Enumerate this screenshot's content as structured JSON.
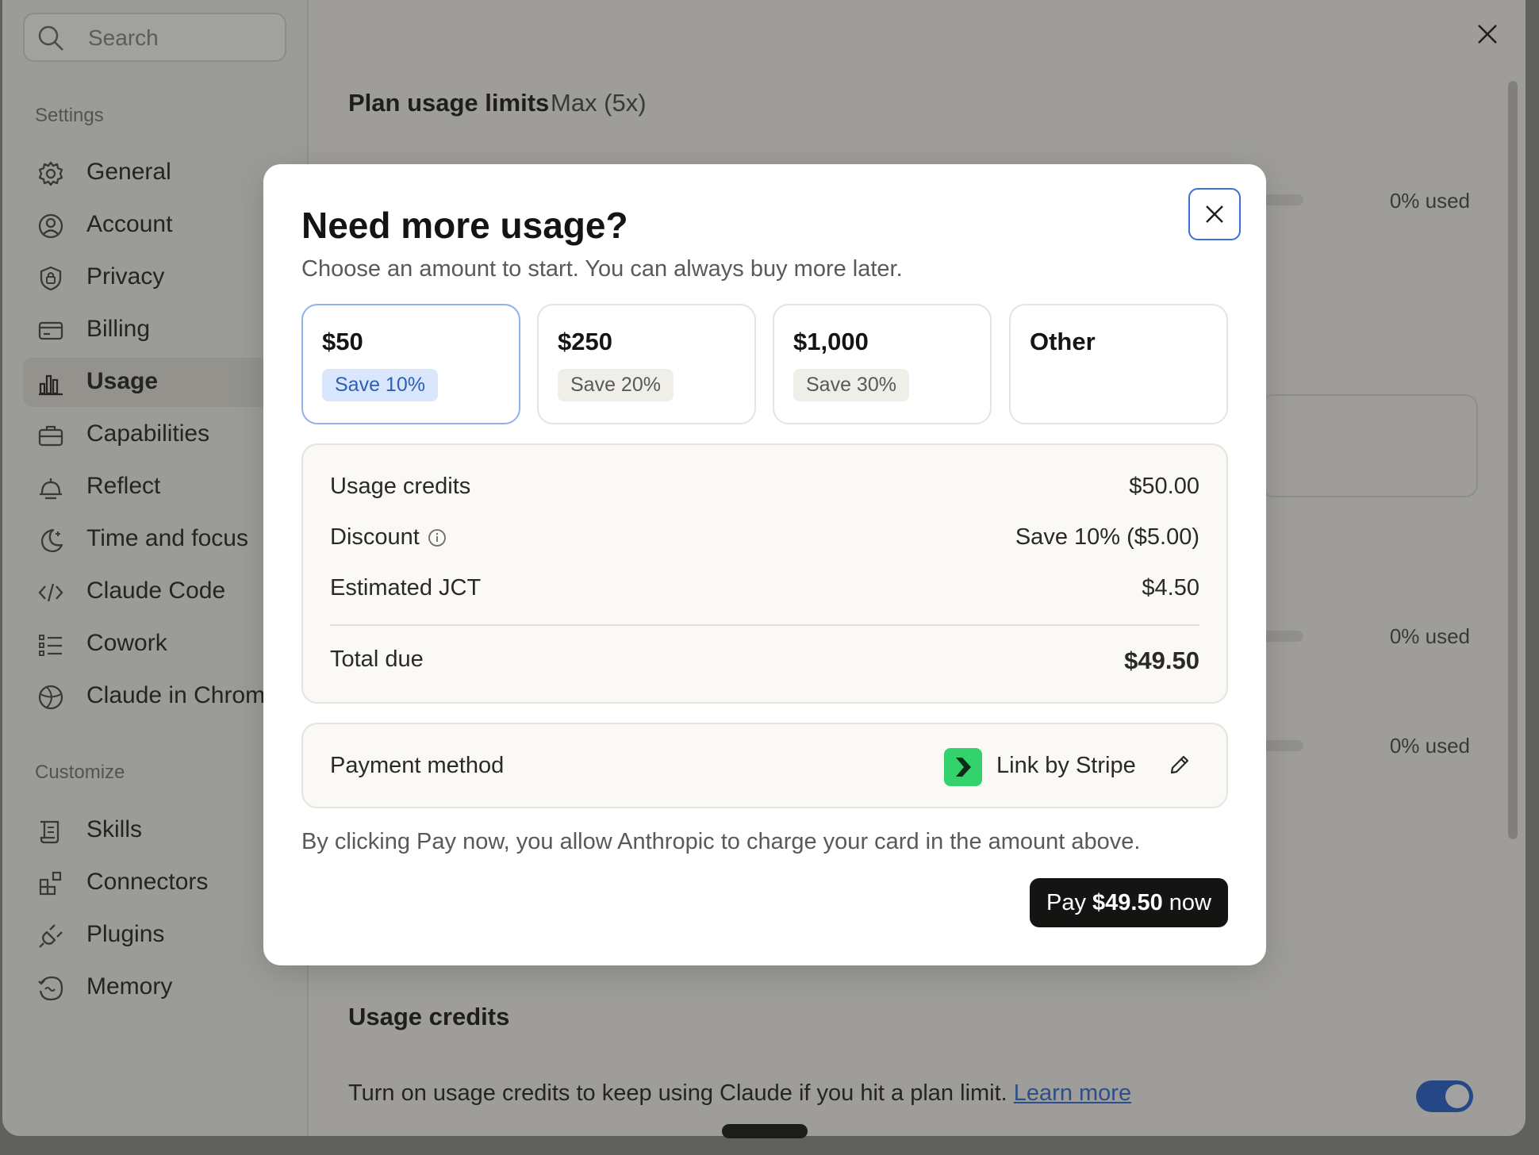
{
  "sidebar": {
    "search_placeholder": "Search",
    "settings_label": "Settings",
    "settings_items": [
      {
        "label": "General",
        "icon": "gear-icon"
      },
      {
        "label": "Account",
        "icon": "user-circle-icon"
      },
      {
        "label": "Privacy",
        "icon": "shield-icon"
      },
      {
        "label": "Billing",
        "icon": "credit-card-icon"
      },
      {
        "label": "Usage",
        "icon": "bar-chart-icon",
        "active": true
      },
      {
        "label": "Capabilities",
        "icon": "briefcase-icon"
      },
      {
        "label": "Reflect",
        "icon": "bell-icon"
      },
      {
        "label": "Time and focus",
        "icon": "moon-icon"
      },
      {
        "label": "Claude Code",
        "icon": "code-icon"
      },
      {
        "label": "Cowork",
        "icon": "list-icon"
      },
      {
        "label": "Claude in Chrome",
        "icon": "globe-icon"
      }
    ],
    "customize_label": "Customize",
    "customize_items": [
      {
        "label": "Skills",
        "icon": "scroll-icon"
      },
      {
        "label": "Connectors",
        "icon": "blocks-icon"
      },
      {
        "label": "Plugins",
        "icon": "plug-icon"
      },
      {
        "label": "Memory",
        "icon": "memory-icon"
      }
    ]
  },
  "main": {
    "title": "Plan usage limits",
    "plan": "Max (5x)",
    "used_labels": [
      "0% used",
      "0% used",
      "0% used"
    ],
    "credits_title": "Usage credits",
    "credits_desc": "Turn on usage credits to keep using Claude if you hit a plan limit.",
    "learn_more": "Learn more",
    "credits_toggle_on": true
  },
  "modal": {
    "title": "Need more usage?",
    "subtitle": "Choose an amount to start. You can always buy more later.",
    "options": [
      {
        "amount": "$50",
        "badge": "Save 10%",
        "selected": true
      },
      {
        "amount": "$250",
        "badge": "Save 20%"
      },
      {
        "amount": "$1,000",
        "badge": "Save 30%"
      },
      {
        "amount": "Other",
        "badge": ""
      }
    ],
    "summary": {
      "usage_credits_label": "Usage credits",
      "usage_credits_value": "$50.00",
      "discount_label": "Discount",
      "discount_value": "Save 10% ($5.00)",
      "tax_label": "Estimated JCT",
      "tax_value": "$4.50",
      "total_label": "Total due",
      "total_value": "$49.50"
    },
    "payment": {
      "label": "Payment method",
      "method": "Link by Stripe"
    },
    "consent": "By clicking Pay now, you allow Anthropic to charge your card in the amount above.",
    "pay_prefix": "Pay ",
    "pay_amount": "$49.50",
    "pay_suffix": " now"
  },
  "colors": {
    "accent": "#3b6fd1",
    "selected_badge_bg": "#d9e6fb",
    "pay_button": "#141413",
    "link_green": "#32d26d"
  }
}
